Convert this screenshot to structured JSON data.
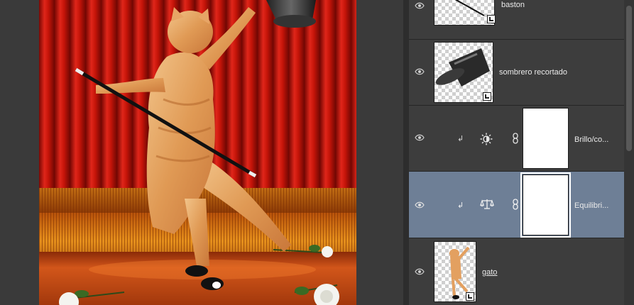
{
  "layers_panel": {
    "layers": [
      {
        "id": "baston",
        "name": "baston",
        "kind": "smart-object",
        "visible": true,
        "selected": false
      },
      {
        "id": "sombrero",
        "name": "sombrero recortado",
        "kind": "smart-object",
        "visible": true,
        "selected": false
      },
      {
        "id": "brillo",
        "name": "Brillo/co...",
        "kind": "adjustment",
        "adjustment_icon": "sun-brightness-icon",
        "clipped": true,
        "visible": true,
        "selected": false
      },
      {
        "id": "equilibrio",
        "name": "Equilibri...",
        "kind": "adjustment",
        "adjustment_icon": "balance-scale-icon",
        "clipped": true,
        "visible": true,
        "selected": true
      },
      {
        "id": "gato",
        "name": "gato",
        "kind": "smart-object",
        "visible": true,
        "selected": false
      }
    ]
  },
  "colors": {
    "selected_row": "#6e7f96",
    "panel_bg": "#3d3d3d",
    "curtain_red": "#c8140c",
    "stage_floor": "#c2440f"
  }
}
